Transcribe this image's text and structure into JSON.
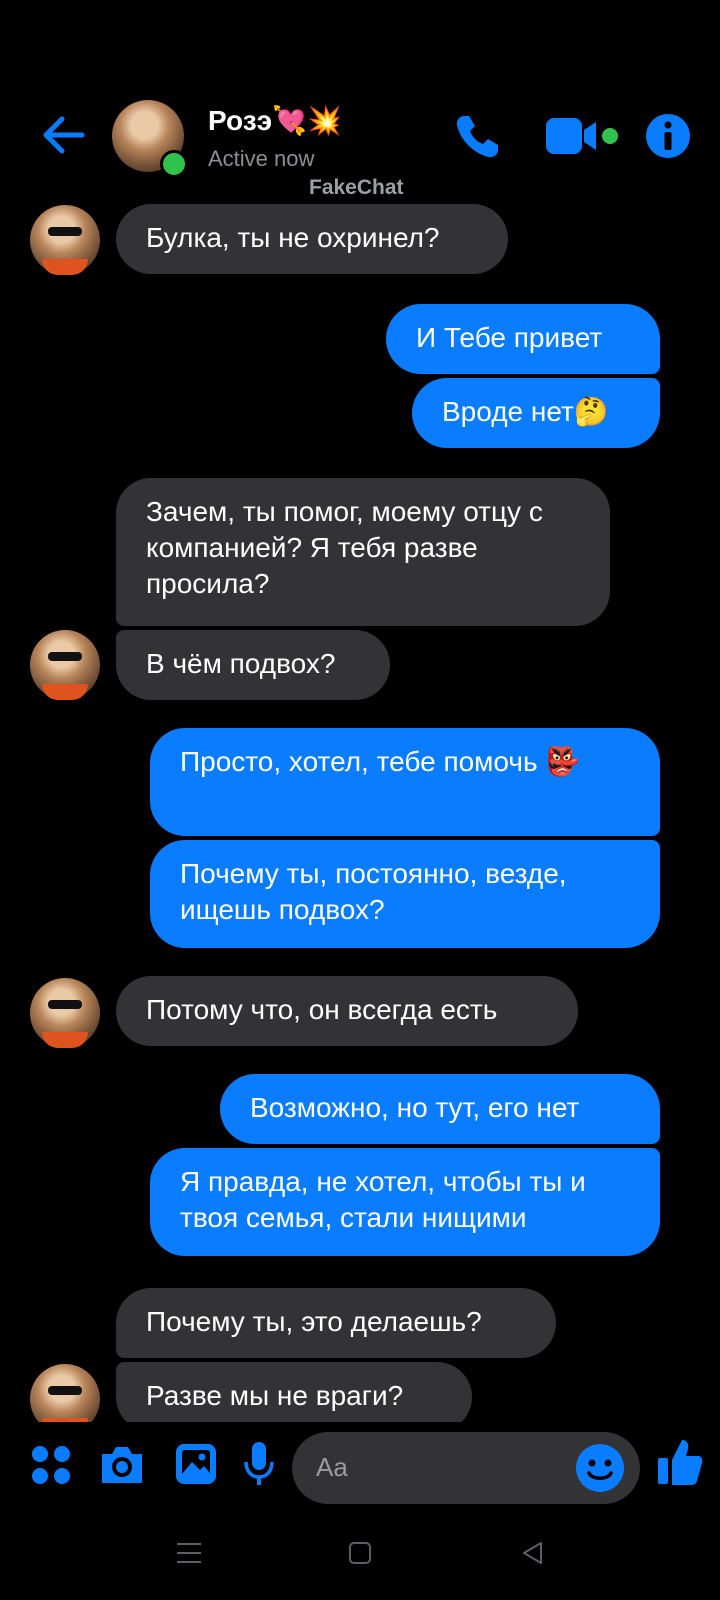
{
  "header": {
    "contact_name": "Розэ💘💥",
    "status": "Active now",
    "watermark": "FakeChat"
  },
  "messages": [
    {
      "side": "in",
      "text": "Булка, ты не охринел?"
    },
    {
      "side": "out",
      "text": "И Тебе привет"
    },
    {
      "side": "out",
      "text": "Вроде нет🤔"
    },
    {
      "side": "in",
      "text": "Зачем, ты помог, моему отцу с компанией? Я тебя разве просила?"
    },
    {
      "side": "in",
      "text": "В чём подвох?"
    },
    {
      "side": "out",
      "text": "Просто, хотел, тебе помочь 👺"
    },
    {
      "side": "out",
      "text": "Почему ты, постоянно, везде, ищешь подвох?"
    },
    {
      "side": "in",
      "text": "Потому что, он всегда есть"
    },
    {
      "side": "out",
      "text": "Возможно, но тут, его нет"
    },
    {
      "side": "out",
      "text": "Я правда, не хотел, чтобы ты и твоя семья, стали нищими"
    },
    {
      "side": "in",
      "text": "Почему ты, это делаешь?"
    },
    {
      "side": "in",
      "text": "Разве мы не враги?"
    }
  ],
  "composer": {
    "placeholder": "Aa"
  },
  "colors": {
    "accent": "#0a7cff",
    "incoming_bubble": "#333336",
    "online": "#31c24d",
    "background": "#000000"
  },
  "icons": [
    "back-arrow-icon",
    "phone-icon",
    "video-camera-icon",
    "info-icon",
    "menu-dots-icon",
    "camera-icon",
    "gallery-icon",
    "microphone-icon",
    "emoji-icon",
    "thumbs-up-icon",
    "nav-menu-icon",
    "nav-home-icon",
    "nav-back-icon"
  ]
}
